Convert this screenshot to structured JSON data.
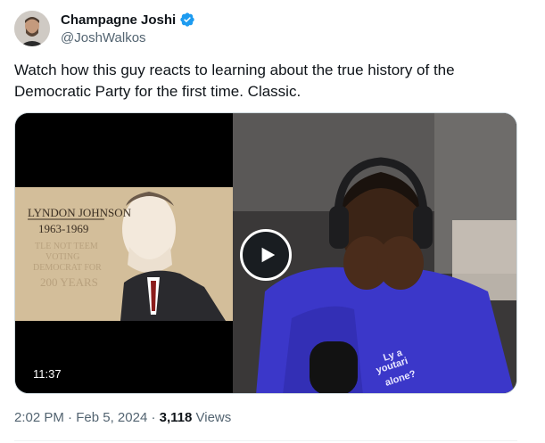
{
  "author": {
    "display_name": "Champagne Joshi",
    "handle": "@JoshWalkos",
    "verified": true,
    "verified_color": "#1d9bf0"
  },
  "tweet": {
    "text_line1": "Watch how this guy reacts to learning about the true history of the",
    "text_line2": "Democratic Party for the first time. Classic."
  },
  "media": {
    "type": "video",
    "duration": "11:37",
    "left_panel": {
      "caption_name": "LYNDON JOHNSON",
      "caption_years": "1963-1969",
      "faded_text_1": "TLE NOT TEEM",
      "faded_text_2": "VOTING",
      "faded_text_3": "DEMOCRAT FOR",
      "faded_text_4": "200 YEARS"
    },
    "shirt_text": [
      "Ly a",
      "youtari",
      "alone?"
    ]
  },
  "footer": {
    "time": "2:02 PM",
    "separator": "·",
    "date": "Feb 5, 2024",
    "views_count": "3,118",
    "views_label": "Views"
  }
}
